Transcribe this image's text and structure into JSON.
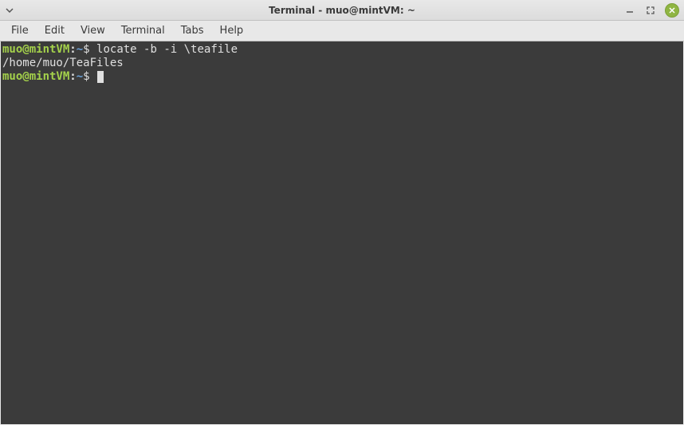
{
  "window": {
    "title": "Terminal - muo@mintVM: ~"
  },
  "menubar": {
    "items": [
      "File",
      "Edit",
      "View",
      "Terminal",
      "Tabs",
      "Help"
    ]
  },
  "terminal": {
    "lines": [
      {
        "type": "prompt",
        "user": "muo@mintVM",
        "sep": ":",
        "path": "~",
        "dollar": "$",
        "command": " locate -b -i \\teafile"
      },
      {
        "type": "output",
        "text": "/home/muo/TeaFiles"
      },
      {
        "type": "prompt",
        "user": "muo@mintVM",
        "sep": ":",
        "path": "~",
        "dollar": "$",
        "command": " ",
        "cursor": true
      }
    ]
  }
}
